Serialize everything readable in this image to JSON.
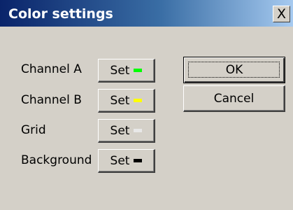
{
  "window": {
    "title": "Color settings",
    "close_glyph": "X"
  },
  "rows": [
    {
      "label": "Channel A",
      "button_label": "Set",
      "swatch_color": "#00ff00"
    },
    {
      "label": "Channel B",
      "button_label": "Set",
      "swatch_color": "#ffff00"
    },
    {
      "label": "Grid",
      "button_label": "Set",
      "swatch_color": "#e8e8e8"
    },
    {
      "label": "Background",
      "button_label": "Set",
      "swatch_color": "#000000"
    }
  ],
  "buttons": {
    "ok_label": "OK",
    "cancel_label": "Cancel"
  },
  "colors": {
    "dialog_background": "#d4d0c8",
    "titlebar_start": "#0a246a",
    "titlebar_end": "#a6caf0"
  }
}
